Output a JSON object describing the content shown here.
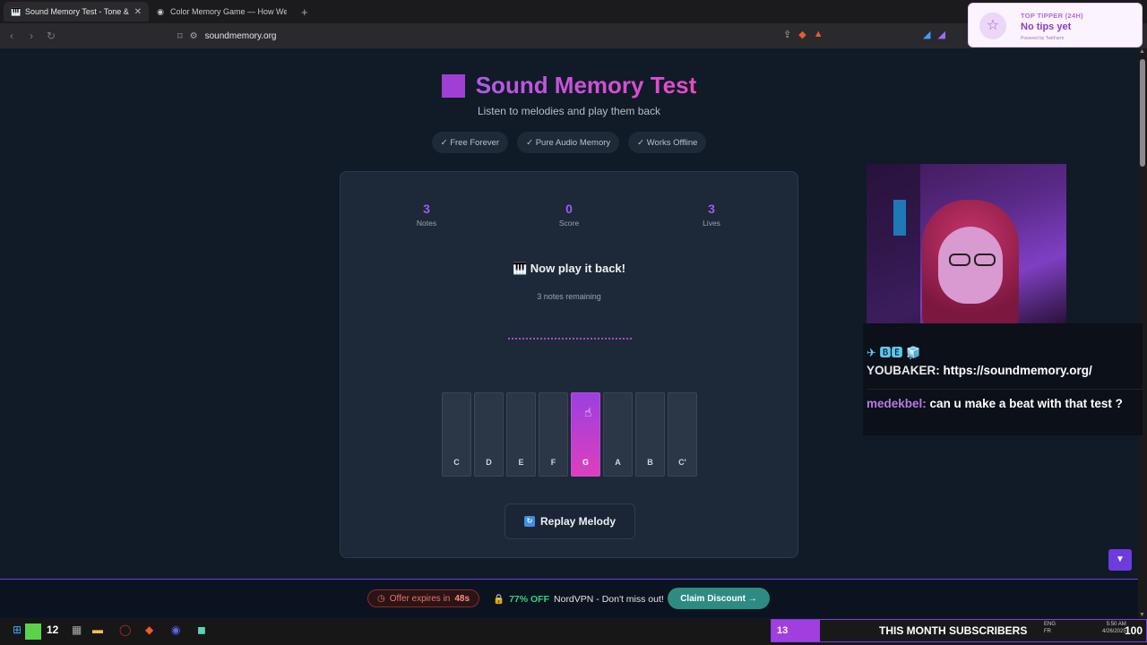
{
  "browser": {
    "tabs": [
      {
        "title": "Sound Memory Test - Tone &",
        "icon": "piano-icon",
        "active": true
      },
      {
        "title": "Color Memory Game — How Well C",
        "icon": "color-wheel-icon",
        "active": false
      }
    ],
    "url": "soundmemory.org"
  },
  "page": {
    "title": "Sound Memory Test",
    "subtitle": "Listen to melodies and play them back",
    "pills": [
      "✓ Free Forever",
      "✓ Pure Audio Memory",
      "✓ Works Offline"
    ]
  },
  "game": {
    "stats": [
      {
        "value": "3",
        "label": "Notes"
      },
      {
        "value": "0",
        "label": "Score"
      },
      {
        "value": "3",
        "label": "Lives"
      }
    ],
    "prompt": "🎹 Now play it back!",
    "remaining": "3 notes remaining",
    "keys": [
      "C",
      "D",
      "E",
      "F",
      "G",
      "A",
      "B",
      "C'"
    ],
    "active_key": "G",
    "replay_label": "Replay Melody"
  },
  "tipper": {
    "label": "TOP TIPPER (24H)",
    "value": "No tips yet",
    "powered": "Powered by TwitFarm"
  },
  "chat": {
    "emotes": "✈ 🅱🅴 🧊",
    "messages": [
      {
        "user": "YOUBAKER:",
        "text": "https://soundmemory.org/"
      },
      {
        "user": "medekbel:",
        "text": "can u make a beat with that test ?"
      }
    ]
  },
  "offer": {
    "timer": "Offer expires in",
    "seconds": "48s",
    "percent": "77% OFF",
    "text": "NordVPN - Don't miss out!",
    "cta": "Claim Discount →"
  },
  "taskbar": {
    "counter": "12",
    "subs_count": "13",
    "subs_label": "THIS MONTH SUBSCRIBERS",
    "subs_goal": "100",
    "subs_progress": 0.13,
    "lang1": "ENG",
    "lang2": "FR",
    "time": "5:50 AM",
    "date": "4/26/2025"
  },
  "colors": {
    "accent": "#9b5cf0",
    "pink": "#dd3fbd",
    "offer_green": "#33d17a",
    "cta": "#2e8b84"
  }
}
